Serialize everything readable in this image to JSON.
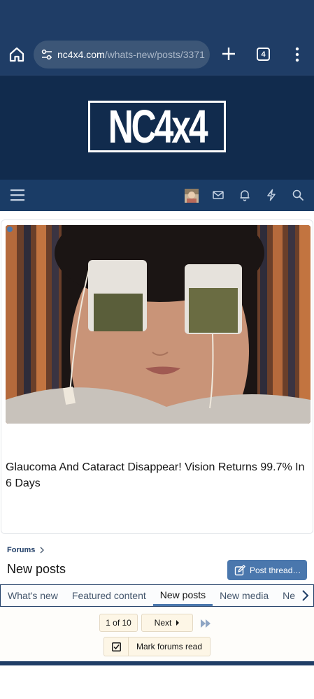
{
  "browser": {
    "url_domain": "nc4x4.com",
    "url_path": "/whats-new/posts/3371",
    "tab_count": "4"
  },
  "site": {
    "logo_text": "NC4x4"
  },
  "ad": {
    "caption": "Glaucoma And Cataract Disappear! Vision Returns 99.7% In 6 Days"
  },
  "breadcrumb": {
    "item": "Forums"
  },
  "page": {
    "title": "New posts",
    "post_thread_label": "Post thread…"
  },
  "tabs": [
    {
      "label": "What's new"
    },
    {
      "label": "Featured content"
    },
    {
      "label": "New posts"
    },
    {
      "label": "New media"
    },
    {
      "label": "Ne"
    }
  ],
  "pagination": {
    "page_indicator": "1 of 10",
    "next_label": "Next"
  },
  "mark_read": {
    "label": "Mark forums read"
  }
}
